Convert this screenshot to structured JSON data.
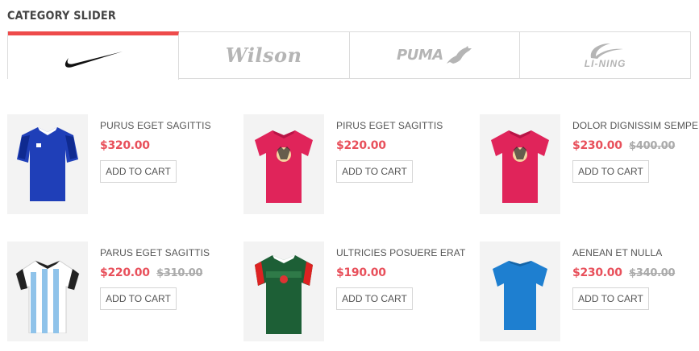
{
  "section": {
    "title": "CATEGORY SLIDER"
  },
  "tabs": [
    {
      "brand": "Nike",
      "logo_text": "",
      "icon": "nike-swoosh-icon",
      "active": true
    },
    {
      "brand": "Wilson",
      "logo_text": "Wilson",
      "icon": "wilson-logo",
      "active": false
    },
    {
      "brand": "Puma",
      "logo_text": "PUMA",
      "icon": "puma-logo",
      "active": false
    },
    {
      "brand": "Li-Ning",
      "logo_text": "LI-NING",
      "icon": "li-ning-logo",
      "active": false
    }
  ],
  "colors": {
    "accent": "#ee4b4b",
    "price": "#e8505b",
    "old_price": "#aaaaaa",
    "logo_gray": "#b5b5b5"
  },
  "products": [
    {
      "name": "PURUS EGET SAGITTIS",
      "price": "$320.00",
      "old_price": "",
      "cart_label": "ADD TO CART",
      "image": "blue-jersey-image"
    },
    {
      "name": "PIRUS EGET SAGITTIS",
      "price": "$220.00",
      "old_price": "",
      "cart_label": "ADD TO CART",
      "image": "pink-tshirt-image"
    },
    {
      "name": "DOLOR DIGNISSIM SEMPER",
      "price": "$230.00",
      "old_price": "$400.00",
      "cart_label": "ADD TO CART",
      "image": "pink-tshirt-image"
    },
    {
      "name": "PARUS EGET SAGITTIS",
      "price": "$220.00",
      "old_price": "$310.00",
      "cart_label": "ADD TO CART",
      "image": "striped-jersey-image"
    },
    {
      "name": "ULTRICIES POSUERE ERAT",
      "price": "$190.00",
      "old_price": "",
      "cart_label": "ADD TO CART",
      "image": "green-jersey-image"
    },
    {
      "name": "AENEAN ET NULLA",
      "price": "$230.00",
      "old_price": "$340.00",
      "cart_label": "ADD TO CART",
      "image": "blue-tshirt-image"
    }
  ]
}
